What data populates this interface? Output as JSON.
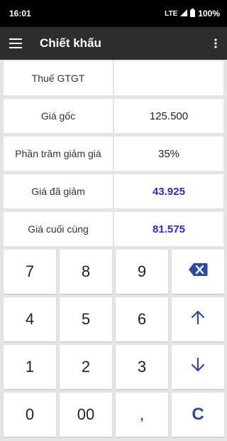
{
  "status": {
    "time": "16:01",
    "network": "LTE",
    "battery": "100%"
  },
  "appbar": {
    "title": "Chiết khấu"
  },
  "rows": [
    {
      "label": "Thuế GTGT",
      "value": "",
      "result": false
    },
    {
      "label": "Giá gốc",
      "value": "125.500",
      "result": false
    },
    {
      "label": "Phần trăm giảm giá",
      "value": "35%",
      "result": false
    },
    {
      "label": "Giá đã giảm",
      "value": "43.925",
      "result": true
    },
    {
      "label": "Giá cuối cùng",
      "value": "81.575",
      "result": true
    }
  ],
  "keypad": {
    "k7": "7",
    "k8": "8",
    "k9": "9",
    "k4": "4",
    "k5": "5",
    "k6": "6",
    "k1": "1",
    "k2": "2",
    "k3": "3",
    "k0": "0",
    "k00": "00",
    "comma": ",",
    "clear": "C"
  },
  "colors": {
    "accent": "#2e4aa8",
    "result": "#2a2adb",
    "appbar": "#2d2d2d"
  }
}
